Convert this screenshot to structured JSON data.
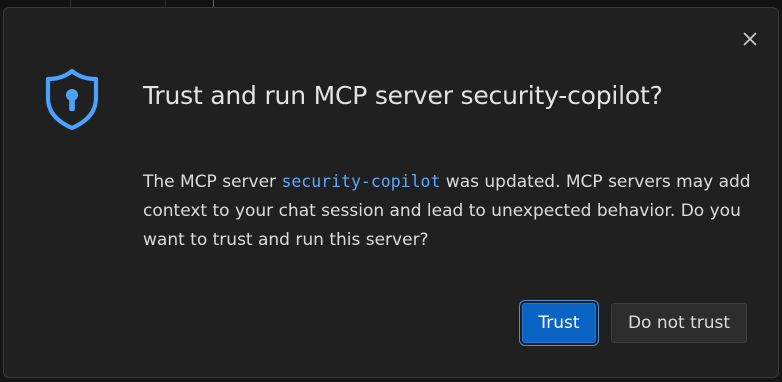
{
  "dialog": {
    "title": "Trust and run MCP server security-copilot?",
    "message": {
      "prefix": "The MCP server ",
      "server_name": "security-copilot",
      "suffix": " was updated. MCP servers may add context to your chat session and lead to unexpected behavior. Do you want to trust and run this server?"
    },
    "buttons": {
      "primary_label": "Trust",
      "secondary_label": "Do not trust"
    },
    "icons": {
      "header": "shield-lock-icon",
      "close": "close-icon"
    }
  },
  "colors": {
    "accent": "#0b64c3",
    "link_code": "#5fa7ff",
    "shield": "#4aa3ff",
    "dialog_background": "#202020"
  }
}
